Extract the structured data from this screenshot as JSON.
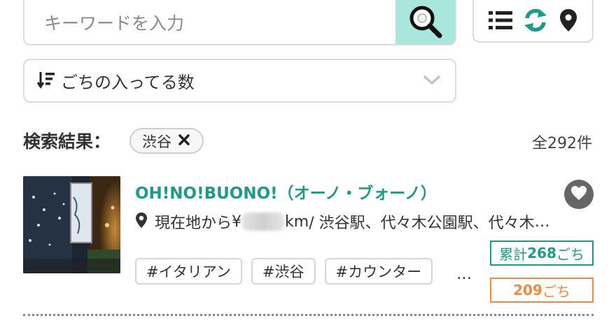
{
  "search": {
    "placeholder": "キーワードを入力",
    "button_icon": "frying-pan-search-icon",
    "accent_color": "#a9e6dc"
  },
  "view_controls": {
    "list_icon": "list-icon",
    "refresh_icon": "refresh-icon",
    "map_icon": "map-pin-icon",
    "accent_color": "#1f9a8a"
  },
  "sort": {
    "icon": "sort-descending-icon",
    "selected": "ごちの入ってる数",
    "chevron_icon": "chevron-down-icon"
  },
  "results": {
    "title": "検索結果：",
    "filter_chip": {
      "label": "渋谷",
      "remove_icon": "close-icon"
    },
    "count": "全292件"
  },
  "items": [
    {
      "name": "OH!NO!BUONO!（オーノ・ブォーノ）",
      "location": {
        "prefix": "現在地から",
        "hidden_start": "¥",
        "unit": "km",
        "stations": " / 渋谷駅、代々木公園駅、代々木",
        "ellipsis": "…"
      },
      "total_label": "累計",
      "total_value": "268",
      "total_unit": "ごち",
      "recent_value": "209",
      "recent_unit": "ごち",
      "tags": [
        "#イタリアン",
        "#渋谷",
        "#カウンター"
      ],
      "more": "…",
      "favorite_icon": "heart-icon"
    }
  ]
}
